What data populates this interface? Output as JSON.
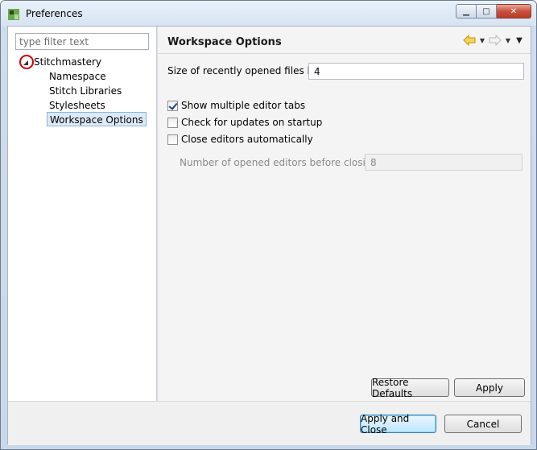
{
  "window": {
    "title": "Preferences",
    "controls": {
      "minimize": "▁",
      "maximize": "□",
      "close": "✕"
    }
  },
  "left": {
    "filter_placeholder": "type filter text",
    "tree": {
      "root": "Stitchmastery",
      "children": [
        "Namespace",
        "Stitch Libraries",
        "Stylesheets",
        "Workspace Options"
      ],
      "selected": "Workspace Options"
    }
  },
  "page": {
    "title": "Workspace Options",
    "nav": {
      "back_icon": "back-arrow-icon",
      "forward_icon": "forward-arrow-icon",
      "menu_icon": "view-menu-icon"
    },
    "recent_files_label": "Size of recently opened files list:",
    "recent_files_value": "4",
    "options": [
      {
        "label": "Show multiple editor tabs",
        "checked": true
      },
      {
        "label": "Check for updates on startup",
        "checked": false
      },
      {
        "label": "Close editors automatically",
        "checked": false
      }
    ],
    "editors_before_closing_label": "Number of opened editors before closing:",
    "editors_before_closing_value": "8",
    "restore_defaults": "Restore Defaults",
    "apply": "Apply"
  },
  "footer": {
    "apply_and_close": "Apply and Close",
    "cancel": "Cancel"
  },
  "colors": {
    "selection_bg": "#dce9f7",
    "selection_border": "#8cb3de",
    "annotation_circle": "#d40000",
    "nav_arrow": "#e8b400"
  }
}
